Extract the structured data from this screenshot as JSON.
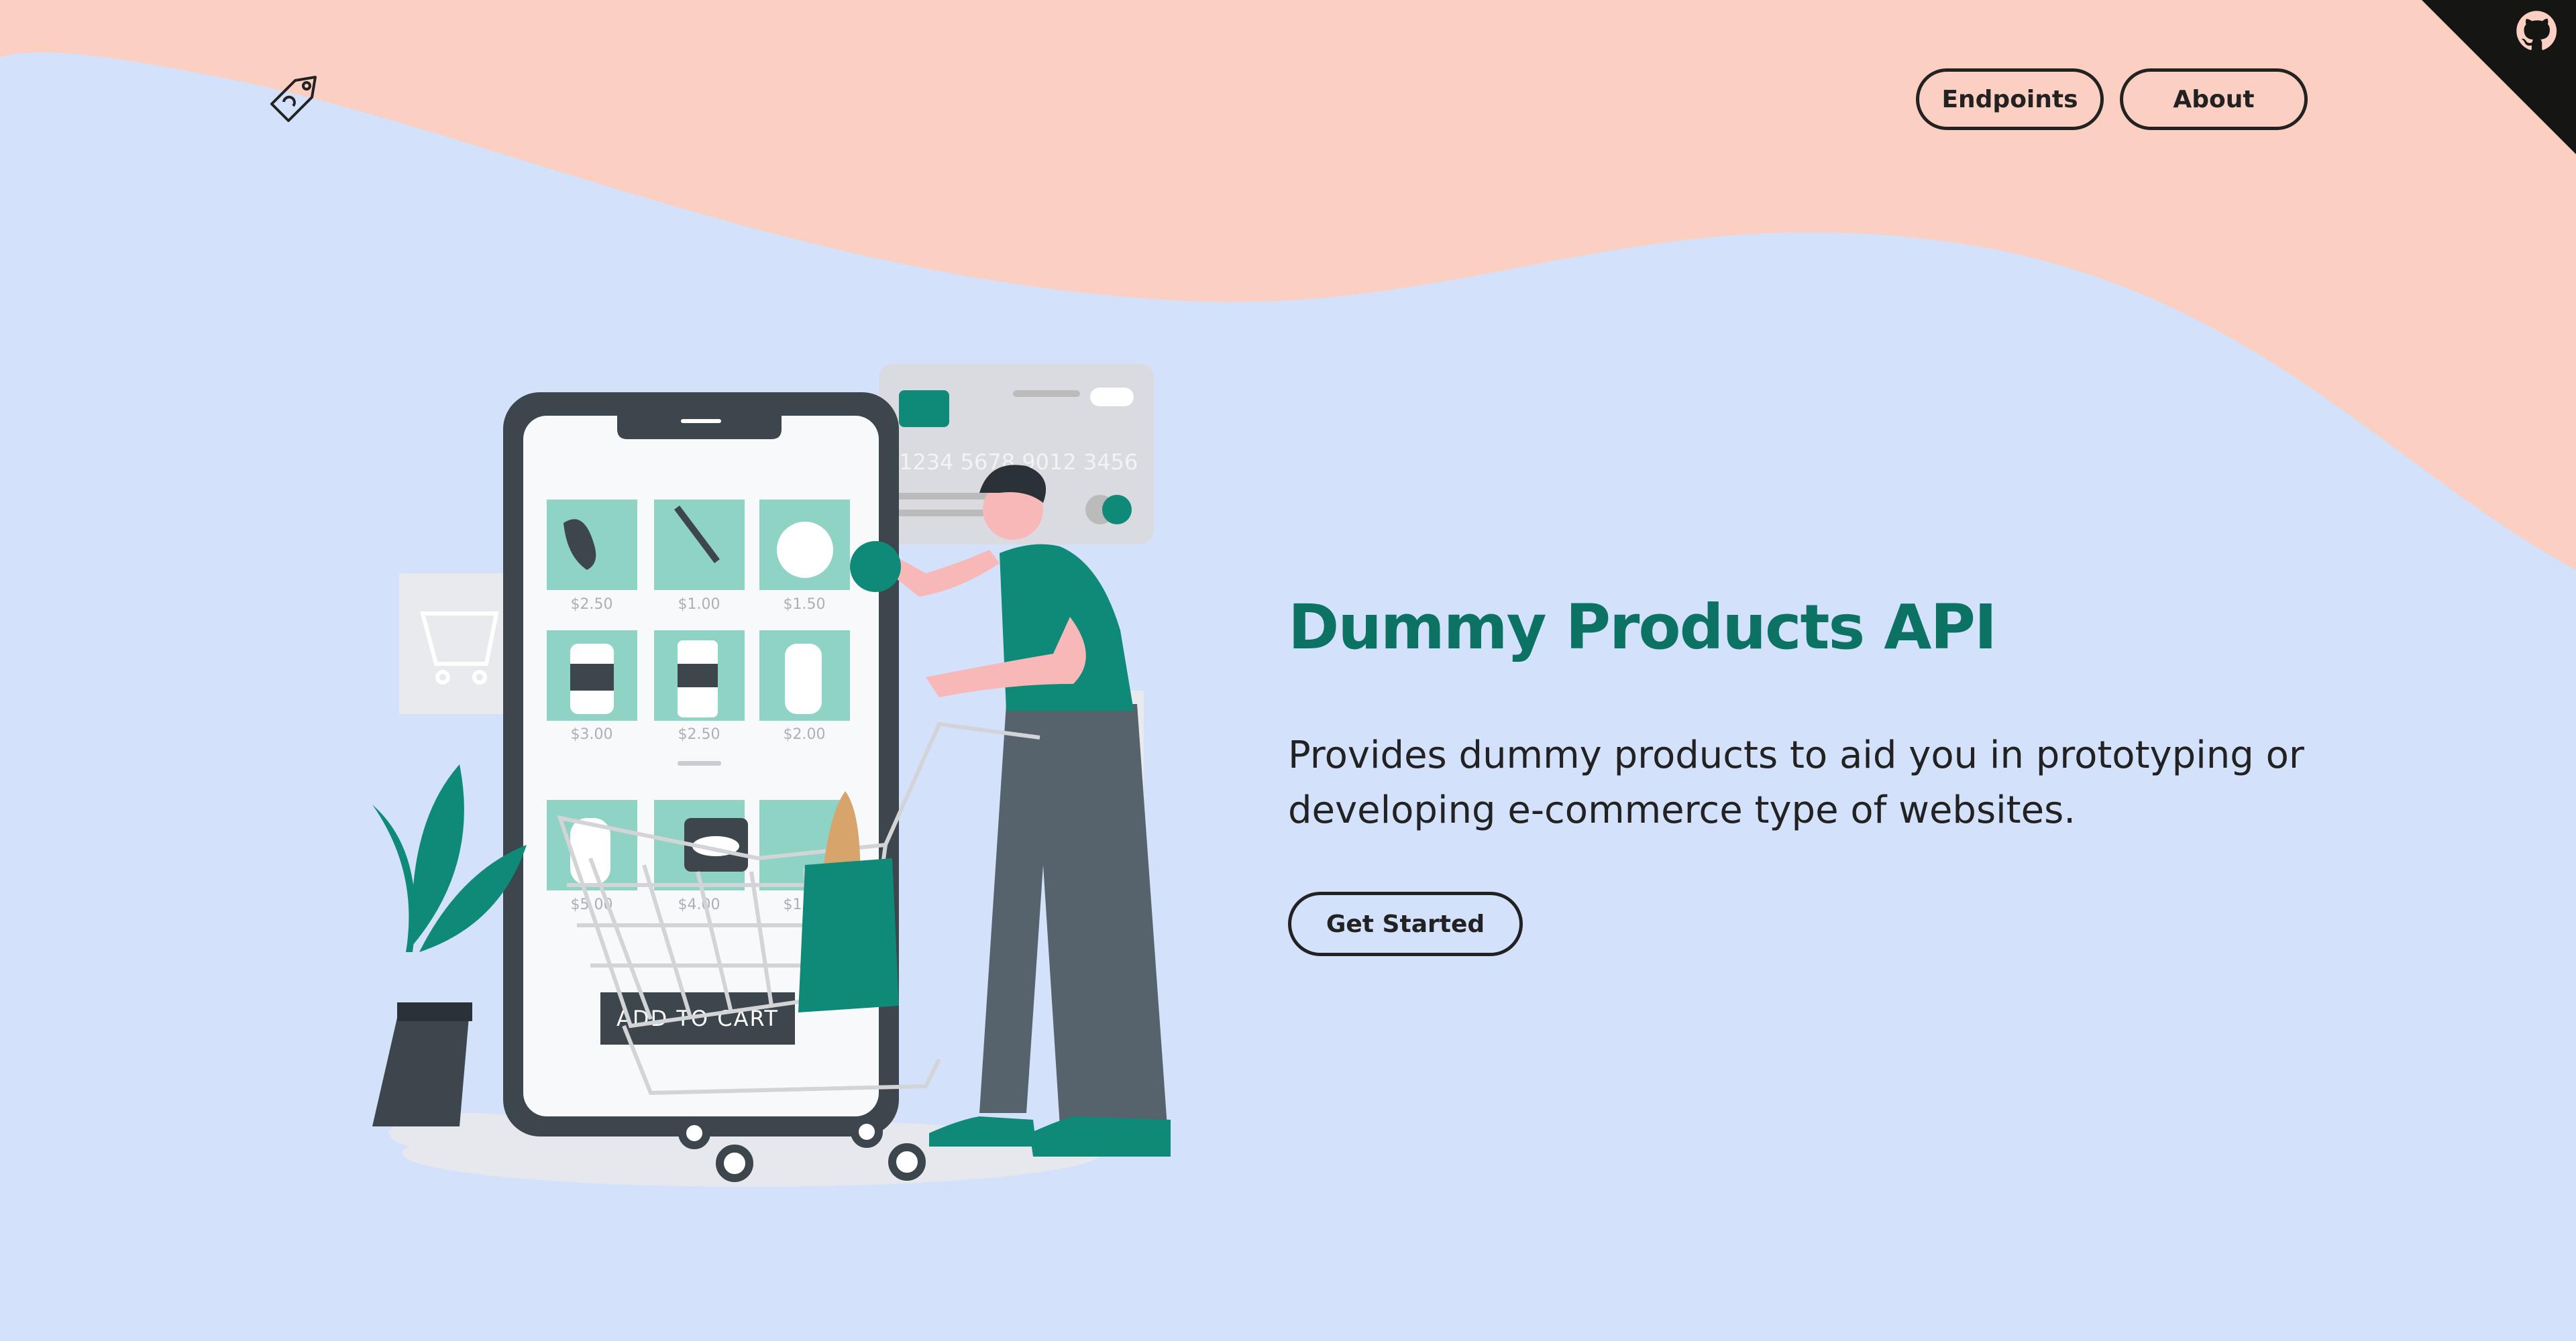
{
  "nav": {
    "endpoints_label": "Endpoints",
    "about_label": "About"
  },
  "hero": {
    "title": "Dummy Products API",
    "description": "Provides dummy products to aid you in prototyping or developing e-commerce type of websites.",
    "cta_label": "Get Started"
  },
  "illustration": {
    "card_number": "1234 5678 9012 3456",
    "prices": [
      "$2.50",
      "$1.00",
      "$1.50",
      "$3.00",
      "$2.50",
      "$2.00",
      "$5.00",
      "$4.00",
      "$1.00"
    ],
    "add_to_cart": "ADD TO CART"
  },
  "icons": {
    "logo": "price-tag-icon",
    "corner": "github-icon"
  },
  "colors": {
    "background": "#d3e2fa",
    "wave": "#fbcfc1",
    "accent": "#0b7264",
    "dark": "#222222"
  }
}
